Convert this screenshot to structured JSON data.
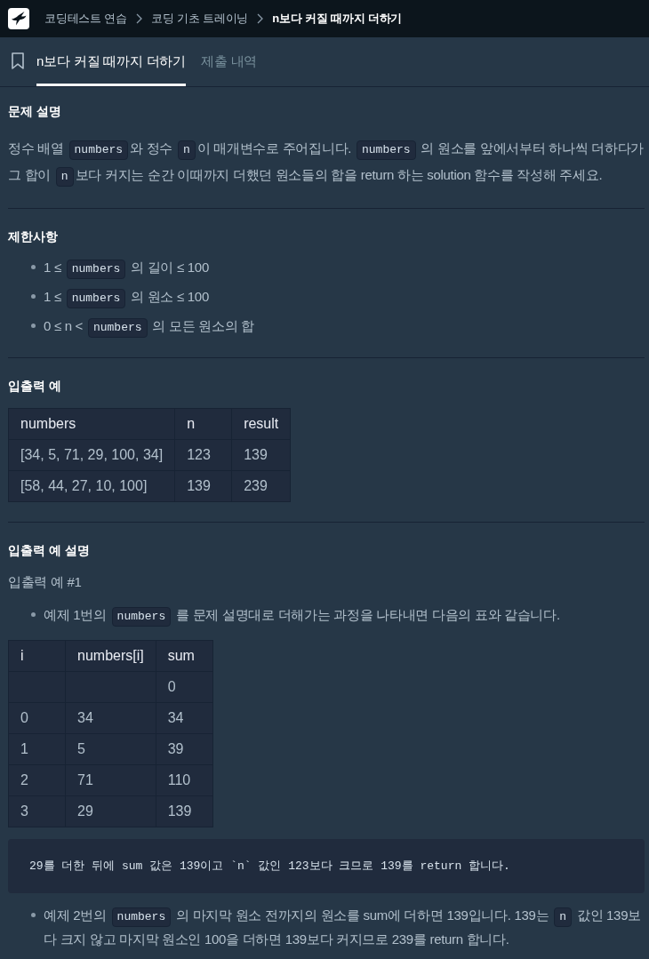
{
  "header": {
    "breadcrumb": [
      {
        "label": "코딩테스트 연습",
        "current": false
      },
      {
        "label": "코딩 기초 트레이닝",
        "current": false
      },
      {
        "label": "n보다 커질 때까지 더하기",
        "current": true
      }
    ]
  },
  "tabs": [
    {
      "label": "n보다 커질 때까지 더하기",
      "selected": true
    },
    {
      "label": "제출 내역",
      "selected": false
    }
  ],
  "sections": [
    {
      "heading": "문제 설명",
      "blocks": [
        {
          "kind": "paragraph",
          "parts": [
            {
              "kind": "text",
              "text": "정수 배열 "
            },
            {
              "kind": "code",
              "text": "numbers"
            },
            {
              "kind": "text",
              "text": "와 정수 "
            },
            {
              "kind": "code",
              "text": "n"
            },
            {
              "kind": "text",
              "text": "이 매개변수로 주어집니다. "
            },
            {
              "kind": "code",
              "text": "numbers"
            },
            {
              "kind": "text",
              "text": " 의 원소를 앞에서부터 하나씩 더하다가 그 합이 "
            },
            {
              "kind": "code",
              "text": "n"
            },
            {
              "kind": "text",
              "text": "보다 커지는 순간 이때까지 더했던 원소들의 합을 return 하는 solution 함수를 작성해 주세요."
            }
          ]
        }
      ]
    },
    {
      "heading": "제한사항",
      "blocks": [
        {
          "kind": "bullets",
          "items": [
            {
              "parts": [
                {
                  "kind": "text",
                  "text": "1 ≤ "
                },
                {
                  "kind": "code",
                  "text": "numbers"
                },
                {
                  "kind": "text",
                  "text": " 의 길이 ≤ 100"
                }
              ]
            },
            {
              "parts": [
                {
                  "kind": "text",
                  "text": "1 ≤ "
                },
                {
                  "kind": "code",
                  "text": "numbers"
                },
                {
                  "kind": "text",
                  "text": " 의 원소 ≤ 100"
                }
              ]
            },
            {
              "parts": [
                {
                  "kind": "text",
                  "text": "0 ≤ n < "
                },
                {
                  "kind": "code",
                  "text": "numbers"
                },
                {
                  "kind": "text",
                  "text": " 의 모든 원소의 합"
                }
              ]
            }
          ]
        }
      ]
    },
    {
      "heading": "입출력 예",
      "blocks": [
        {
          "kind": "table",
          "columns": [
            "numbers",
            "n",
            "result"
          ],
          "rows": [
            [
              "[34, 5, 71, 29, 100, 34]",
              "123",
              "139"
            ],
            [
              "[58, 44, 27, 10, 100]",
              "139",
              "239"
            ]
          ]
        }
      ]
    },
    {
      "heading": "입출력 예 설명",
      "blocks": [
        {
          "kind": "subheading",
          "text": "입출력 예 #1"
        },
        {
          "kind": "bullets",
          "items": [
            {
              "parts": [
                {
                  "kind": "text",
                  "text": "예제 1번의 "
                },
                {
                  "kind": "code",
                  "text": "numbers"
                },
                {
                  "kind": "text",
                  "text": " 를 문제 설명대로 더해가는 과정을 나타내면 다음의 표와 같습니다."
                }
              ]
            }
          ]
        },
        {
          "kind": "table",
          "columns": [
            "i",
            "numbers[i]",
            "sum"
          ],
          "rows": [
            [
              null,
              null,
              "0"
            ],
            [
              "0",
              "34",
              "34"
            ],
            [
              "1",
              "5",
              "39"
            ],
            [
              "2",
              "71",
              "110"
            ],
            [
              "3",
              "29",
              "139"
            ]
          ]
        },
        {
          "kind": "code",
          "text": "29를 더한 뒤에 sum 값은 139이고 `n` 값인 123보다 크므로 139를 return 합니다."
        },
        {
          "kind": "bullets",
          "items": [
            {
              "parts": [
                {
                  "kind": "text",
                  "text": "예제 2번의 "
                },
                {
                  "kind": "code",
                  "text": "numbers"
                },
                {
                  "kind": "text",
                  "text": " 의 마지막 원소 전까지의 원소를 sum에 더하면 139입니다. 139는 "
                },
                {
                  "kind": "code",
                  "text": "n"
                },
                {
                  "kind": "text",
                  "text": " 값인 139보다 크지 않고 마지막 원소인 100을 더하면 139보다 커지므로 239를 return 합니다."
                }
              ]
            }
          ]
        }
      ]
    }
  ]
}
